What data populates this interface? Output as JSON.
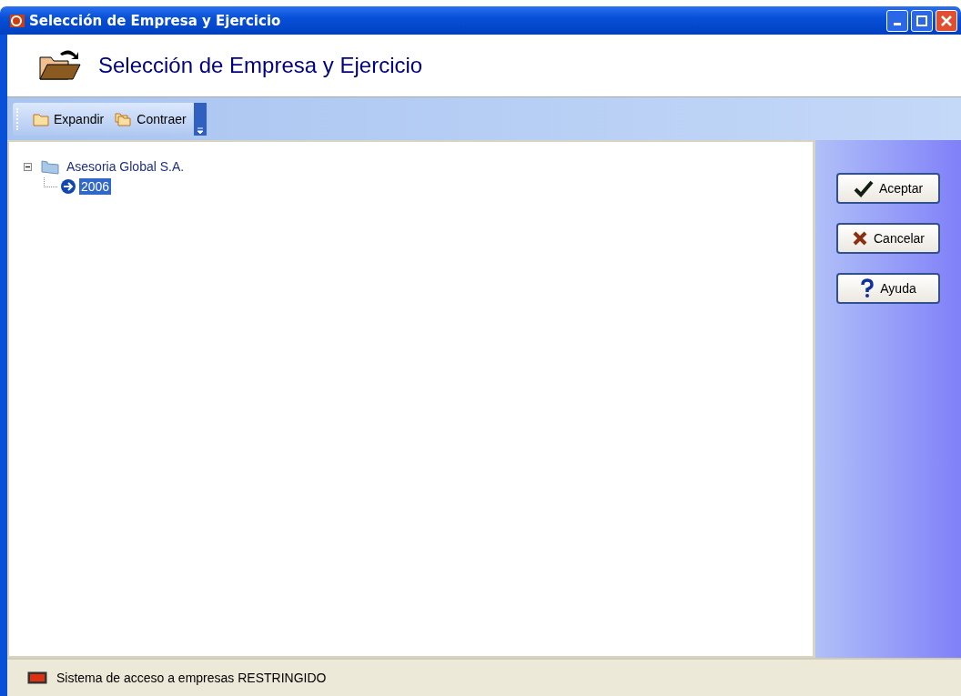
{
  "window": {
    "title": "Selección de Empresa y Ejercicio"
  },
  "header": {
    "title": "Selección de Empresa y Ejercicio"
  },
  "toolbar": [
    {
      "label": "Expandir",
      "kind": "expand"
    },
    {
      "label": "Contraer",
      "kind": "collapse"
    }
  ],
  "tree": [
    {
      "label": "Asesoria Global S.A.",
      "expanded": true,
      "selected": false,
      "children": [
        {
          "label": "2006",
          "selected": true
        }
      ]
    }
  ],
  "buttons": [
    {
      "label": "Aceptar",
      "kind": "ok"
    },
    {
      "label": "Cancelar",
      "kind": "cancel"
    },
    {
      "label": "Ayuda",
      "kind": "help"
    }
  ],
  "status_bar": {
    "text": "Sistema de acceso a empresas RESTRINGIDO"
  }
}
